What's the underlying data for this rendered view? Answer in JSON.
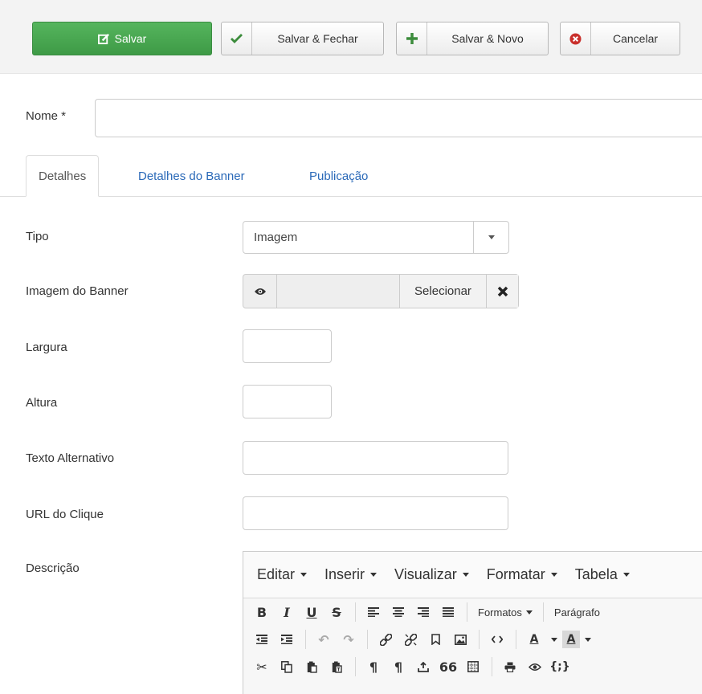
{
  "toolbar": {
    "save_label": "Salvar",
    "save_close_label": "Salvar & Fechar",
    "save_new_label": "Salvar & Novo",
    "cancel_label": "Cancelar"
  },
  "form": {
    "name_label": "Nome *",
    "name_value": "",
    "tabs": [
      "Detalhes",
      "Detalhes do Banner",
      "Publicação"
    ],
    "type_label": "Tipo",
    "type_value": "Imagem",
    "image_label": "Imagem do Banner",
    "image_select_label": "Selecionar",
    "width_label": "Largura",
    "height_label": "Altura",
    "alt_label": "Texto Alternativo",
    "url_label": "URL do Clique",
    "description_label": "Descrição"
  },
  "editor": {
    "menus": [
      "Editar",
      "Inserir",
      "Visualizar",
      "Formatar",
      "Tabela"
    ],
    "formats_label": "Formatos",
    "paragraph_label": "Parágrafo",
    "code_label": "{;}"
  },
  "colors": {
    "save_green": "#4cae4c",
    "check_green": "#3c8c3c",
    "cancel_red": "#c9302c",
    "link_blue": "#2a69b8"
  }
}
